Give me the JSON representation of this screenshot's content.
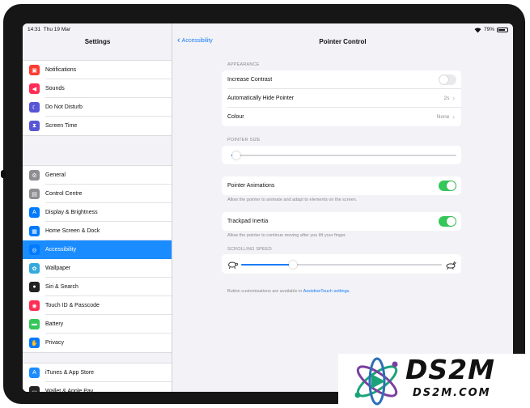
{
  "status": {
    "time": "14:31",
    "date": "Thu 19 Mar",
    "battery": "79%"
  },
  "sidebar": {
    "title": "Settings",
    "groups": [
      {
        "items": [
          {
            "label": "Notifications",
            "icon": "notifications-icon",
            "color": "#ff3b30"
          },
          {
            "label": "Sounds",
            "icon": "sounds-icon",
            "color": "#ff2d55"
          },
          {
            "label": "Do Not Disturb",
            "icon": "moon-icon",
            "color": "#5856d6"
          },
          {
            "label": "Screen Time",
            "icon": "hourglass-icon",
            "color": "#5856d6"
          }
        ]
      },
      {
        "items": [
          {
            "label": "General",
            "icon": "gear-icon",
            "color": "#8e8e93"
          },
          {
            "label": "Control Centre",
            "icon": "control-centre-icon",
            "color": "#8e8e93"
          },
          {
            "label": "Display & Brightness",
            "icon": "display-icon",
            "color": "#007aff"
          },
          {
            "label": "Home Screen & Dock",
            "icon": "home-screen-icon",
            "color": "#007aff"
          },
          {
            "label": "Accessibility",
            "icon": "accessibility-icon",
            "color": "#007aff",
            "selected": true
          },
          {
            "label": "Wallpaper",
            "icon": "wallpaper-icon",
            "color": "#34aadc"
          },
          {
            "label": "Siri & Search",
            "icon": "siri-icon",
            "color": "#222222"
          },
          {
            "label": "Touch ID & Passcode",
            "icon": "fingerprint-icon",
            "color": "#ff2d55"
          },
          {
            "label": "Battery",
            "icon": "battery-icon",
            "color": "#34c759"
          },
          {
            "label": "Privacy",
            "icon": "hand-icon",
            "color": "#007aff"
          }
        ]
      },
      {
        "items": [
          {
            "label": "iTunes & App Store",
            "icon": "app-store-icon",
            "color": "#1a8cff"
          },
          {
            "label": "Wallet & Apple Pay",
            "icon": "wallet-icon",
            "color": "#222222"
          }
        ]
      }
    ]
  },
  "detail": {
    "back_label": "Accessibility",
    "title": "Pointer Control",
    "appearance_header": "APPEARANCE",
    "increase_contrast": {
      "label": "Increase Contrast",
      "on": false
    },
    "auto_hide": {
      "label": "Automatically Hide Pointer",
      "value": "2s"
    },
    "colour": {
      "label": "Colour",
      "value": "None"
    },
    "pointer_size_header": "POINTER SIZE",
    "pointer_size_value": 0.02,
    "pointer_animations": {
      "label": "Pointer Animations",
      "on": true,
      "note": "Allow the pointer to animate and adapt to elements on the screen."
    },
    "trackpad_inertia": {
      "label": "Trackpad Inertia",
      "on": true,
      "note": "Allow the pointer to continue moving after you lift your finger."
    },
    "scrolling_speed_header": "SCROLLING SPEED",
    "scrolling_speed_value": 0.26,
    "footer_prefix": "Button customisations are available in ",
    "footer_link": "AssistiveTouch settings."
  },
  "watermark": {
    "brand": "DS2M",
    "domain": "DS2M.COM"
  }
}
